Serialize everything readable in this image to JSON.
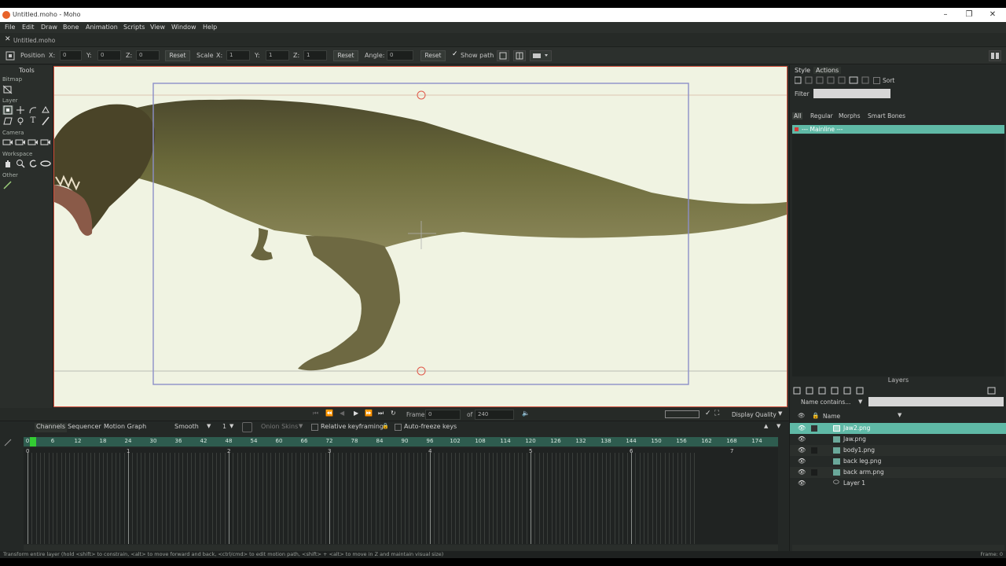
{
  "window": {
    "title": "Untitled.moho - Moho",
    "min": "–",
    "max": "❐",
    "close": "✕"
  },
  "menu": [
    "File",
    "Edit",
    "Draw",
    "Bone",
    "Animation",
    "Scripts",
    "View",
    "Window",
    "Help"
  ],
  "doc_tab": {
    "label": "Untitled.moho"
  },
  "toolbar": {
    "position_label": "Position",
    "x_label": "X:",
    "x_value": "0",
    "y_label": "Y:",
    "y_value": "0",
    "z_label": "Z:",
    "z_value": "0",
    "reset1": "Reset",
    "scale_label": "Scale",
    "sx_label": "X:",
    "sx_value": "1",
    "sy_label": "Y:",
    "sy_value": "1",
    "sz_label": "Z:",
    "sz_value": "1",
    "reset2": "Reset",
    "angle_label": "Angle:",
    "angle_value": "0",
    "reset3": "Reset",
    "show_path_label": "Show path"
  },
  "tools": {
    "title": "Tools",
    "sections": {
      "bitmap": "Bitmap",
      "layer": "Layer",
      "camera": "Camera",
      "workspace": "Workspace",
      "other": "Other"
    }
  },
  "playback": {
    "frame_label": "Frame",
    "frame_value": "0",
    "of_label": "of",
    "of_value": "240",
    "display_quality": "Display Quality"
  },
  "timeline": {
    "tabs": [
      "Channels",
      "Sequencer",
      "Motion Graph"
    ],
    "interp": "Smooth",
    "interp_num": "1",
    "onion": "Onion Skins",
    "relative": "Relative keyframing",
    "autofreeze": "Auto-freeze keys",
    "ruler": [
      "0",
      "6",
      "12",
      "18",
      "24",
      "30",
      "36",
      "42",
      "48",
      "54",
      "60",
      "66",
      "72",
      "78",
      "84",
      "90",
      "96",
      "102",
      "108",
      "114",
      "120",
      "126",
      "132",
      "138",
      "144",
      "150",
      "156",
      "162",
      "168",
      "174"
    ],
    "seconds": [
      "0",
      "1",
      "2",
      "3",
      "4",
      "5",
      "6",
      "7"
    ]
  },
  "style_panel": {
    "tabs": [
      "Style",
      "Actions"
    ],
    "sort": "Sort",
    "filter_label": "Filter",
    "subtabs": [
      "All",
      "Regular",
      "Morphs",
      "Smart Bones"
    ],
    "mainline": "--- Mainline ---"
  },
  "layers_panel": {
    "title": "Layers",
    "name_contains": "Name contains...",
    "name_header": "Name",
    "items": [
      "Jaw2.png",
      "Jaw.png",
      "body1.png",
      "back leg.png",
      "back arm.png",
      "Layer 1"
    ]
  },
  "status": {
    "text": "Transform entire layer (hold <shift> to constrain, <alt> to move forward and back, <ctrl/cmd> to edit motion path, <shift> + <alt> to move in Z and maintain visual size)",
    "frame": "Frame: 0"
  },
  "colors": {
    "accent": "#5fb9a6",
    "canvas_bg": "#f0f3e2",
    "canvas_border": "#d2503c",
    "selection_box": "#8c8fc8",
    "green_marker": "#33cc33"
  }
}
